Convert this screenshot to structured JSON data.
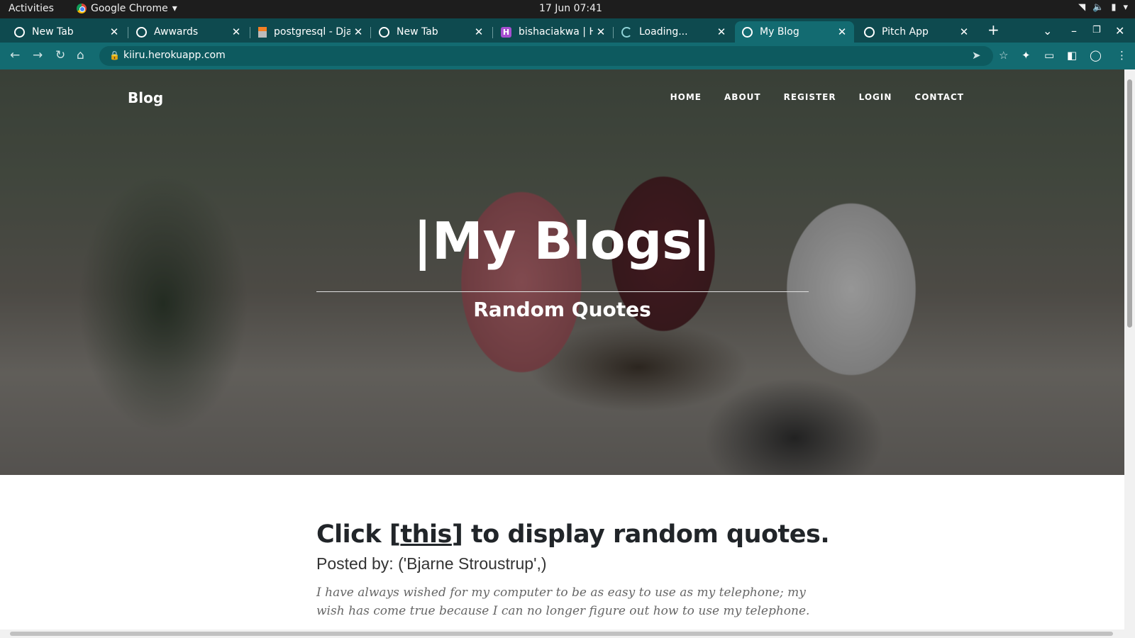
{
  "system": {
    "activities": "Activities",
    "app_name": "Google Chrome",
    "clock": "17 Jun  07:41"
  },
  "tabs": [
    {
      "title": "New Tab",
      "icon": "chrome-icon"
    },
    {
      "title": "Awwards",
      "icon": "globe-icon"
    },
    {
      "title": "postgresql - Dja",
      "icon": "stackoverflow-icon"
    },
    {
      "title": "New Tab",
      "icon": "chrome-icon"
    },
    {
      "title": "bishaciakwa | H",
      "icon": "heroku-icon"
    },
    {
      "title": "Loading...",
      "icon": "loading-icon"
    },
    {
      "title": "My Blog",
      "icon": "globe-icon",
      "active": true
    },
    {
      "title": "Pitch App",
      "icon": "globe-icon"
    }
  ],
  "toolbar": {
    "url": "kiiru.herokuapp.com"
  },
  "site": {
    "brand": "Blog",
    "nav": [
      "HOME",
      "ABOUT",
      "REGISTER",
      "LOGIN",
      "CONTACT"
    ],
    "hero_title": "|My Blogs|",
    "hero_subtitle": "Random Quotes"
  },
  "post": {
    "title_prefix": "Click [",
    "title_link": "this",
    "title_suffix": "] to display random quotes.",
    "meta": "Posted by: ('Bjarne Stroustrup',)",
    "excerpt": "I have always wished for my computer to be as easy to use as my telephone; my wish has come true because I can no longer figure out how to use my telephone."
  },
  "colors": {
    "tabstrip": "#0e4a4f",
    "toolbar": "#136b71",
    "heading": "#212529"
  }
}
